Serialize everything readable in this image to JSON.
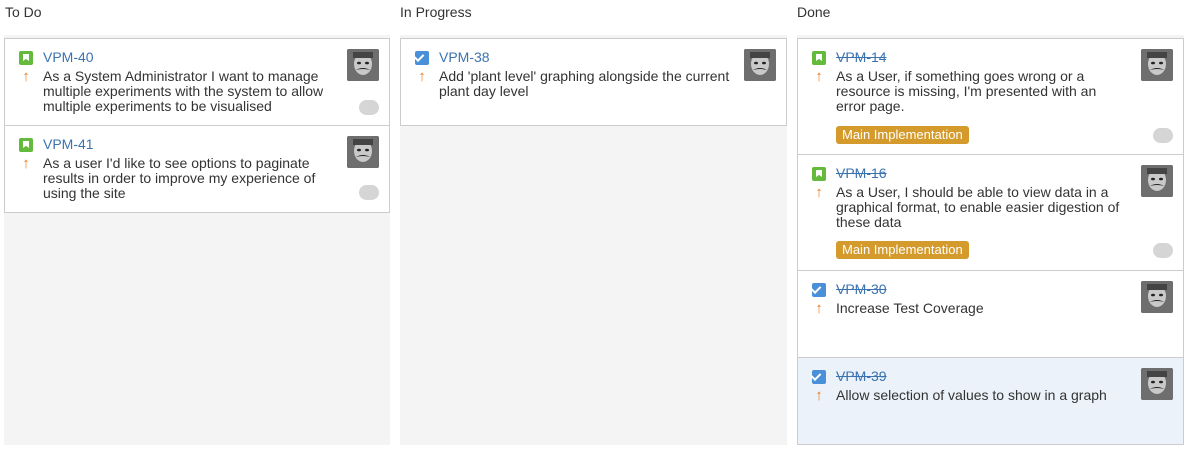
{
  "columns": [
    {
      "title": "To Do",
      "cards": [
        {
          "key": "VPM-40",
          "type": "story",
          "done": false,
          "summary": "As a System Administrator I want to manage multiple experiments with the system to allow multiple experiments to be visualised"
        },
        {
          "key": "VPM-41",
          "type": "story",
          "done": false,
          "summary": "As a user I'd like to see options to paginate results in order to improve my experience of using the site"
        }
      ]
    },
    {
      "title": "In Progress",
      "cards": [
        {
          "key": "VPM-38",
          "type": "task",
          "done": false,
          "summary": "Add 'plant level' graphing alongside the current plant day level"
        }
      ]
    },
    {
      "title": "Done",
      "cards": [
        {
          "key": "VPM-14",
          "type": "story",
          "done": true,
          "summary": "As a User, if something goes wrong or a resource is missing, I'm presented with an error page.",
          "epic": "Main Implementation"
        },
        {
          "key": "VPM-16",
          "type": "story",
          "done": true,
          "summary": "As a User, I should be able to view data in a graphical format, to enable easier digestion of these data",
          "epic": "Main Implementation"
        },
        {
          "key": "VPM-30",
          "type": "task",
          "done": true,
          "summary": "Increase Test Coverage"
        },
        {
          "key": "VPM-39",
          "type": "task",
          "done": true,
          "selected": true,
          "summary": "Allow selection of values to show in a graph"
        }
      ]
    }
  ],
  "colors": {
    "story": "#63ba3c",
    "task": "#4a90d9",
    "priority": "#f07a1c",
    "epic": "#d49a2c",
    "link": "#3b73af"
  },
  "icons": {
    "story": "story-icon",
    "task": "task-icon",
    "priority": "priority-arrow-icon",
    "avatar": "user-avatar",
    "toggle": "toggle-icon"
  }
}
